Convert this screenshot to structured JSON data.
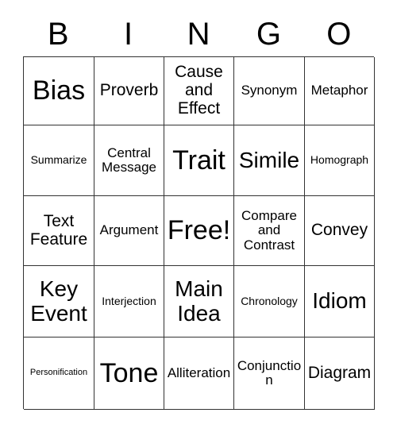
{
  "card": {
    "header_letters": [
      "B",
      "I",
      "N",
      "G",
      "O"
    ],
    "colors": {
      "background": "#ffffff",
      "text": "#000000",
      "grid_line": "#333333"
    },
    "rows": [
      [
        {
          "label": "Bias",
          "size": "xl"
        },
        {
          "label": "Proverb",
          "size": "md"
        },
        {
          "label": "Cause and Effect",
          "size": "md"
        },
        {
          "label": "Synonym",
          "size": "sm"
        },
        {
          "label": "Metaphor",
          "size": "sm"
        }
      ],
      [
        {
          "label": "Summarize",
          "size": "xs"
        },
        {
          "label": "Central Message",
          "size": "sm"
        },
        {
          "label": "Trait",
          "size": "xl"
        },
        {
          "label": "Simile",
          "size": "lg"
        },
        {
          "label": "Homograph",
          "size": "xs"
        }
      ],
      [
        {
          "label": "Text Feature",
          "size": "md"
        },
        {
          "label": "Argument",
          "size": "sm"
        },
        {
          "label": "Free!",
          "size": "xl"
        },
        {
          "label": "Compare and Contrast",
          "size": "sm"
        },
        {
          "label": "Convey",
          "size": "md"
        }
      ],
      [
        {
          "label": "Key Event",
          "size": "lg"
        },
        {
          "label": "Interjection",
          "size": "xs"
        },
        {
          "label": "Main Idea",
          "size": "lg"
        },
        {
          "label": "Chronology",
          "size": "xs"
        },
        {
          "label": "Idiom",
          "size": "lg"
        }
      ],
      [
        {
          "label": "Personification",
          "size": "xxs"
        },
        {
          "label": "Tone",
          "size": "xl"
        },
        {
          "label": "Alliteration",
          "size": "sm"
        },
        {
          "label": "Conjunction",
          "size": "sm"
        },
        {
          "label": "Diagram",
          "size": "md"
        }
      ]
    ]
  }
}
